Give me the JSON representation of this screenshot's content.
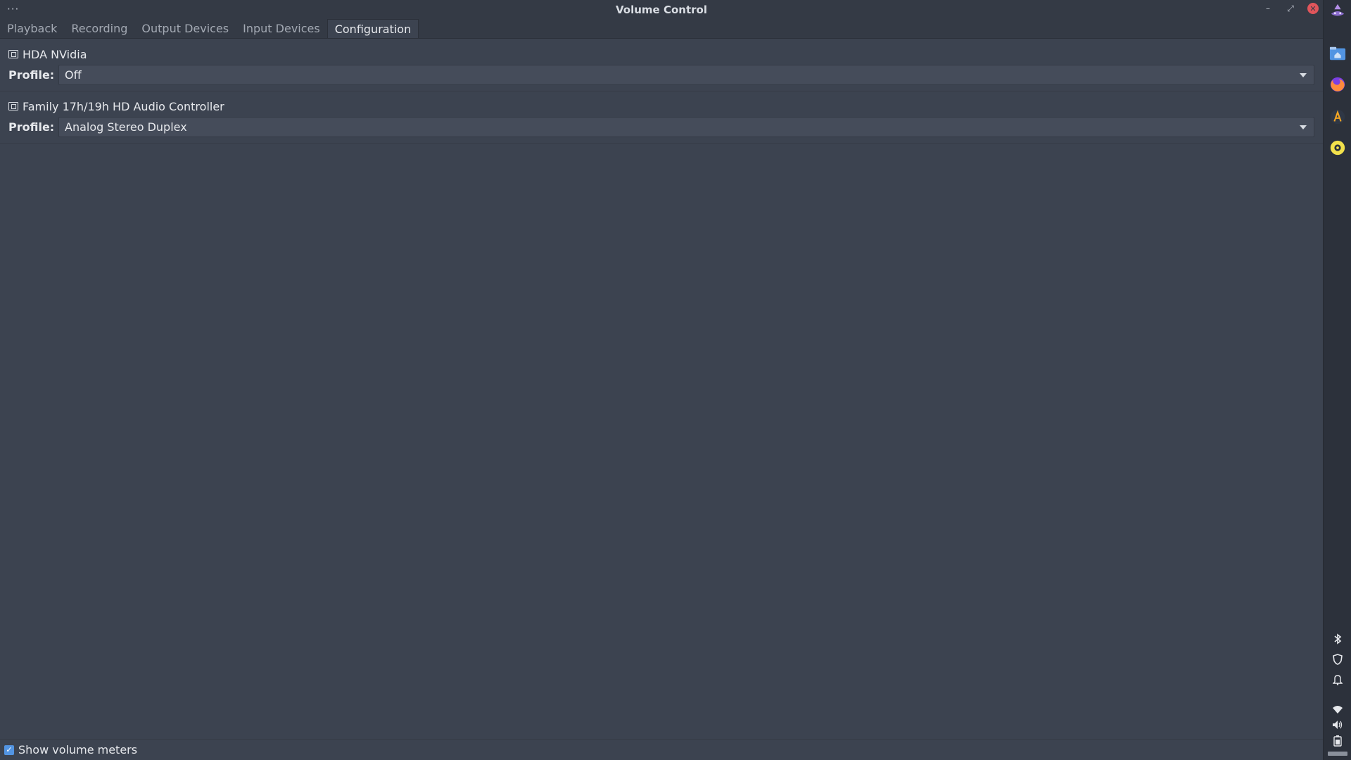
{
  "window": {
    "title": "Volume Control",
    "menu_dots": "···",
    "controls": {
      "minimize": "–",
      "restore": "⤢",
      "close": "✕"
    }
  },
  "tabs": [
    {
      "label": "Playback",
      "active": false
    },
    {
      "label": "Recording",
      "active": false
    },
    {
      "label": "Output Devices",
      "active": false
    },
    {
      "label": "Input Devices",
      "active": false
    },
    {
      "label": "Configuration",
      "active": true
    }
  ],
  "cards": [
    {
      "name": "HDA NVidia",
      "profile_label": "Profile:",
      "profile_value": "Off"
    },
    {
      "name": "Family 17h/19h HD Audio Controller",
      "profile_label": "Profile:",
      "profile_value": "Analog Stereo Duplex"
    }
  ],
  "footer": {
    "show_meters_label": "Show volume meters",
    "show_meters_checked": true
  },
  "dock": {
    "apps": [
      "menu-icon",
      "home-folder-icon",
      "firefox-icon",
      "text-editor-icon",
      "music-player-icon"
    ],
    "tray": [
      "bluetooth-icon",
      "shield-icon",
      "notification-icon",
      "wifi-icon",
      "volume-icon",
      "battery-icon"
    ]
  },
  "colors": {
    "window_bg": "#3c4350",
    "titlebar_bg": "#343a45",
    "accent": "#5294e2",
    "close_button": "#e0555b",
    "dock_bg": "#2c313b"
  }
}
